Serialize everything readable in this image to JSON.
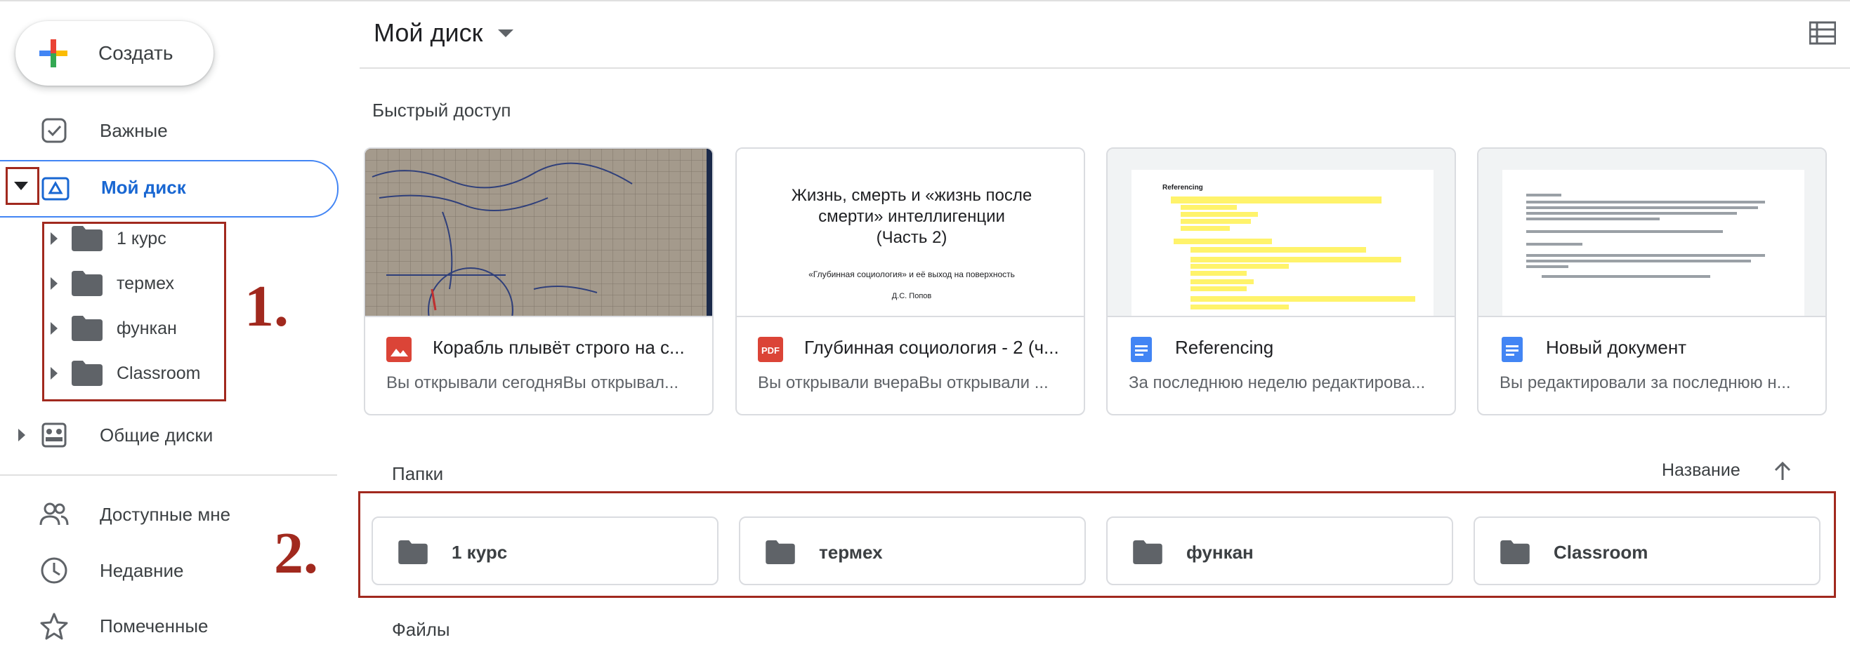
{
  "sidebar": {
    "create_label": "Создать",
    "items": {
      "important": "Важные",
      "my_drive": "Мой диск",
      "shared_drives": "Общие диски",
      "shared_with_me": "Доступные мне",
      "recent": "Недавние",
      "starred": "Помеченные"
    },
    "tree": [
      "1 курс",
      "термех",
      "функан",
      "Classroom"
    ]
  },
  "annotations": {
    "first": "1.",
    "second": "2."
  },
  "main": {
    "title": "Мой диск",
    "quick_access": {
      "title": "Быстрый доступ",
      "cards": [
        {
          "name": "Корабль плывёт строго на с...",
          "sub": "Вы открывали сегодняВы открывал...",
          "icon": "image-file-icon"
        },
        {
          "name": "Глубинная социология - 2 (ч...",
          "sub": "Вы открывали вчераВы открывали ...",
          "icon": "pdf-file-icon"
        },
        {
          "name": "Referencing",
          "sub": "За последнюю неделю редактирова...",
          "icon": "docs-file-icon"
        },
        {
          "name": "Новый документ",
          "sub": "Вы редактировали за последнюю н...",
          "icon": "docs-file-icon"
        }
      ],
      "pdf_preview": {
        "heading": "Жизнь, смерть и «жизнь после смерти» интеллигенции",
        "part": "(Часть 2)",
        "subtitle": "«Глубинная социология» и её выход на поверхность",
        "author": "Д.С. Попов"
      },
      "doc_preview_title": "Referencing"
    },
    "folders": {
      "title": "Папки",
      "sort_label": "Название",
      "items": [
        "1 курс",
        "термех",
        "функан",
        "Classroom"
      ]
    },
    "files_title": "Файлы"
  },
  "colors": {
    "accent": "#1967d2",
    "annotation": "#a1291e",
    "folder": "#5f6368",
    "pdf": "#db4437",
    "docs": "#4285f4"
  }
}
